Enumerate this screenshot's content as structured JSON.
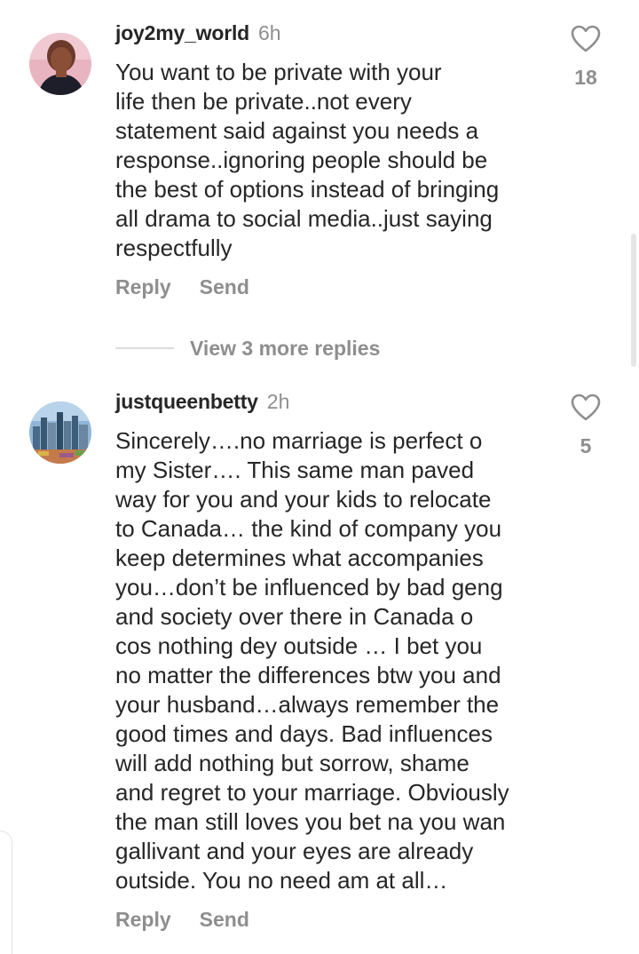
{
  "comments": [
    {
      "username": "joy2my_world",
      "time": "6h",
      "avatar_icon": "profile-photo-woman",
      "lines": [
        "You want to be private with your",
        "life then be private..not every",
        "statement said against you needs a",
        "response..ignoring people should be",
        "the best of options instead of bringing",
        "all drama to social media..just saying",
        "respectfully"
      ],
      "reply_label": "Reply",
      "send_label": "Send",
      "likes": "18",
      "like_icon": "heart-outline-icon"
    },
    {
      "username": "justqueenbetty",
      "time": "2h",
      "avatar_icon": "profile-photo-city-skyline",
      "lines": [
        "Sincerely….no marriage is perfect o",
        "my Sister…. This same man paved",
        "way for you and your kids to relocate",
        "to Canada… the kind of company you",
        "keep determines what accompanies",
        "you…don’t be influenced by bad geng",
        "and society over there in Canada o",
        "cos nothing dey outside … I bet you",
        "no matter the differences btw you and",
        "your husband…always remember the",
        "good times and days. Bad influences",
        "will add nothing but sorrow, shame",
        "and regret to your marriage. Obviously",
        "the man still loves you bet na you wan",
        "gallivant and your eyes are already",
        "outside. You no need am at all…"
      ],
      "reply_label": "Reply",
      "send_label": "Send",
      "likes": "5",
      "like_icon": "heart-outline-icon"
    }
  ],
  "view_more_replies": "View 3 more replies",
  "colors": {
    "text": "#262626",
    "secondary": "#8e8e8e",
    "divider": "#dbdbdb"
  }
}
